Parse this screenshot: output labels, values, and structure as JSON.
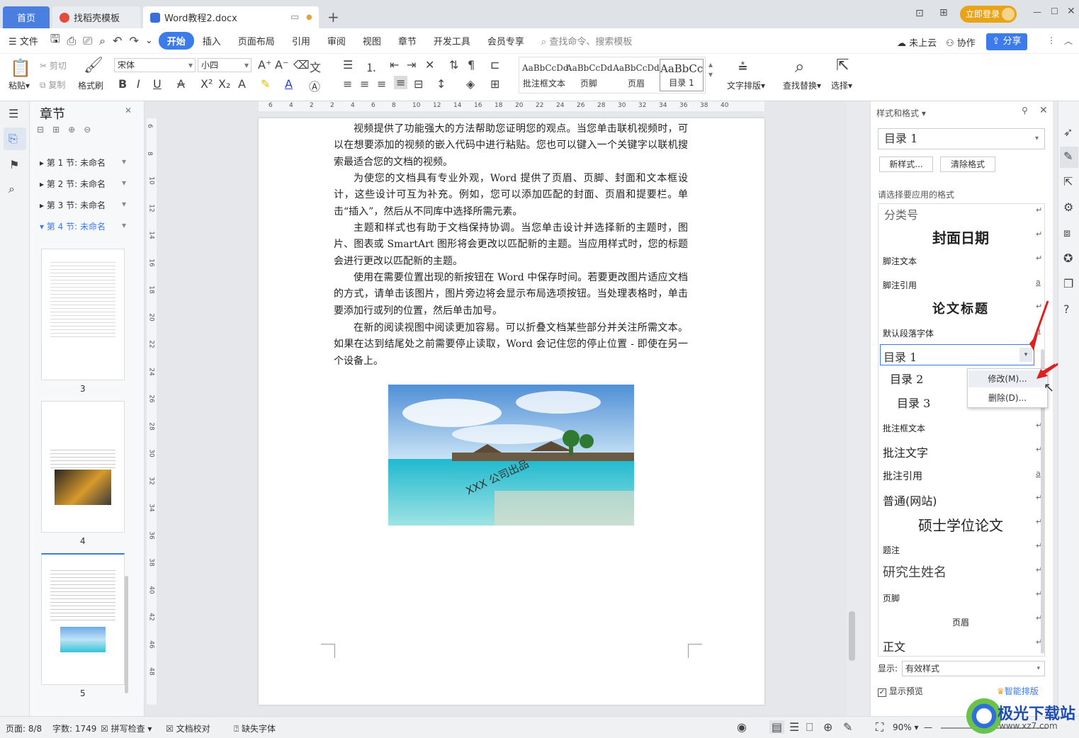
{
  "tabs": {
    "home": "首页",
    "template": "找稻壳模板",
    "doc": "Word教程2.docx"
  },
  "titlebar": {
    "login": "立即登录"
  },
  "menu": {
    "file": "文件",
    "items": [
      "开始",
      "插入",
      "页面布局",
      "引用",
      "审阅",
      "视图",
      "章节",
      "开发工具",
      "会员专享"
    ],
    "search": "查找命令、搜索模板",
    "cloud": "未上云",
    "collab": "协作",
    "share": "分享"
  },
  "ribbon": {
    "paste": "粘贴",
    "cut": "剪切",
    "copy": "复制",
    "format_painter": "格式刷",
    "font": "宋体",
    "size": "小四",
    "styles": [
      {
        "sample": "AaBbCcDd",
        "name": "批注框文本"
      },
      {
        "sample": "AaBbCcDd",
        "name": "页脚"
      },
      {
        "sample": "AaBbCcDd",
        "name": "页眉"
      },
      {
        "sample": "AaBbCcI",
        "name": "目录 1"
      }
    ],
    "text_layout": "文字排版",
    "find_replace": "查找替换",
    "select": "选择"
  },
  "nav": {
    "title": "章节",
    "sections": [
      "第 1 节: 未命名",
      "第 2 节: 未命名",
      "第 3 节: 未命名",
      "第 4 节: 未命名"
    ],
    "pages": [
      "3",
      "4",
      "5"
    ]
  },
  "ruler": {
    "h": [
      "6",
      "4",
      "2",
      "2",
      "4",
      "6",
      "8",
      "10",
      "12",
      "14",
      "16",
      "18",
      "20",
      "22",
      "24",
      "26",
      "28",
      "30",
      "32",
      "34",
      "36",
      "38",
      "40"
    ],
    "v": [
      "6",
      "8",
      "10",
      "12",
      "14",
      "16",
      "18",
      "20",
      "22",
      "24",
      "26",
      "28",
      "30",
      "32",
      "34",
      "36",
      "38",
      "40",
      "42",
      "46",
      "48"
    ]
  },
  "document": {
    "paragraphs": [
      "视频提供了功能强大的方法帮助您证明您的观点。当您单击联机视频时，可以在想要添加的视频的嵌入代码中进行粘贴。您也可以键入一个关键字以联机搜索最适合您的文档的视频。",
      "为使您的文档具有专业外观，Word 提供了页眉、页脚、封面和文本框设计，这些设计可互为补充。例如，您可以添加匹配的封面、页眉和提要栏。单击“插入”，然后从不同库中选择所需元素。",
      "主题和样式也有助于文档保持协调。当您单击设计并选择新的主题时，图片、图表或 SmartArt 图形将会更改以匹配新的主题。当应用样式时，您的标题会进行更改以匹配新的主题。",
      "使用在需要位置出现的新按钮在 Word 中保存时间。若要更改图片适应文档的方式，请单击该图片，图片旁边将会显示布局选项按钮。当处理表格时，单击要添加行或列的位置，然后单击加号。",
      "在新的阅读视图中阅读更加容易。可以折叠文档某些部分并关注所需文本。如果在达到结尾处之前需要停止读取，Word 会记住您的停止位置 - 即使在另一个设备上。"
    ],
    "watermark": "XXX 公司出品"
  },
  "styles_pane": {
    "title": "样式和格式",
    "current": "目录  1",
    "new_style": "新样式...",
    "clear_format": "清除格式",
    "choose_label": "请选择要应用的格式",
    "items": [
      "分类号",
      "封面日期",
      "脚注文本",
      "脚注引用",
      "论文标题",
      "默认段落字体",
      "目录  1",
      "目录  2",
      "目录  3",
      "批注框文本",
      "批注文字",
      "批注引用",
      "普通(网站)",
      "硕士学位论文",
      "题注",
      "研究生姓名",
      "页脚",
      "页眉",
      "正文"
    ],
    "context_menu": [
      "修改(M)...",
      "删除(D)..."
    ],
    "show_label": "显示:",
    "show_value": "有效样式",
    "preview": "显示预览",
    "smart_layout": "智能排版"
  },
  "status": {
    "page": "页面: 8/8",
    "words": "字数: 1749",
    "spell": "拼写检查",
    "proof": "文档校对",
    "missing_font": "缺失字体",
    "zoom": "90%"
  },
  "watermark_site": "极光下载站",
  "watermark_url": "www.xz7.com"
}
